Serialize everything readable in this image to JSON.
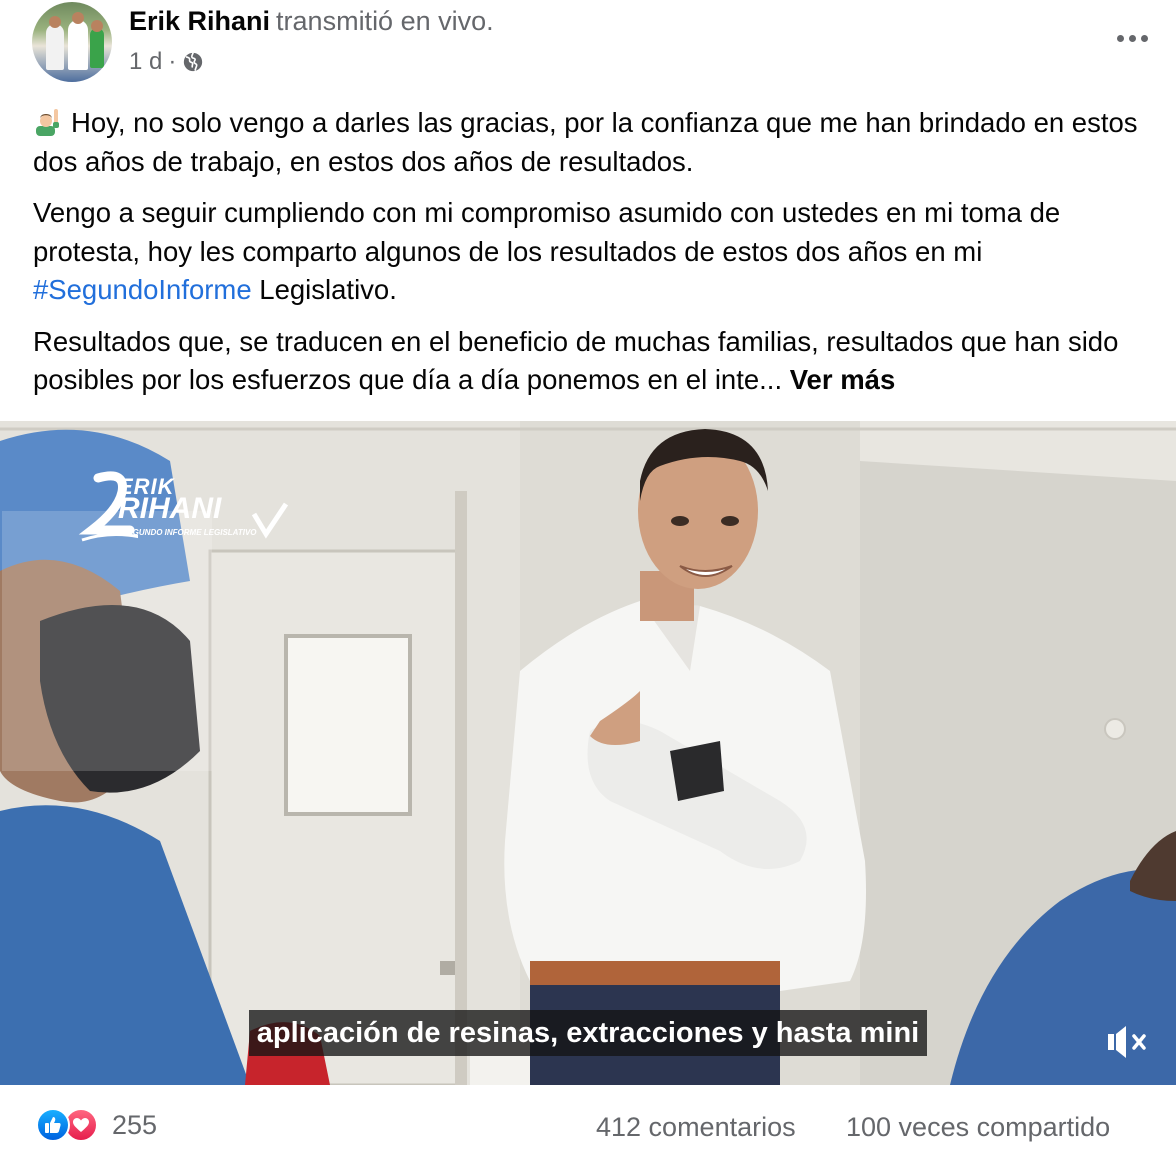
{
  "post": {
    "author": "Erik Rihani",
    "action": "transmitió en vivo.",
    "time": "1 d",
    "separator": "·",
    "privacy_icon": "globe-icon",
    "more_icon": "more-options-icon"
  },
  "content": {
    "emoji_icon": "person-raising-hand-emoji",
    "paragraph1": "Hoy, no solo vengo a darles las gracias, por la confianza que me han brindado en estos dos años de trabajo, en estos dos años de resultados.",
    "paragraph2_before": "Vengo a seguir cumpliendo con mi compromiso asumido con ustedes en mi toma de protesta, hoy les comparto algunos de los resultados de estos dos años en mi ",
    "hashtag": "#SegundoInforme",
    "paragraph2_after": " Legislativo.",
    "paragraph3": "Resultados que, se traducen en el beneficio de muchas familias, resultados que han sido posibles por los esfuerzos que día a día ponemos en el inte...",
    "see_more": "Ver más"
  },
  "video": {
    "subtitle": "aplicación de resinas, extracciones y hasta mini",
    "watermark_top": "ERIK",
    "watermark_main": "RIHANI",
    "watermark_sub": "SEGUNDO INFORME LEGISLATIVO",
    "mute_icon": "speaker-muted-icon"
  },
  "footer": {
    "reaction_icons": [
      "like-icon",
      "love-icon"
    ],
    "reaction_count": "255",
    "comments": "412 comentarios",
    "shares": "100 veces compartido"
  },
  "colors": {
    "link": "#216fdb",
    "secondary_text": "#65676b",
    "like_blue": "#0866ff",
    "love_red": "#f33e58"
  }
}
